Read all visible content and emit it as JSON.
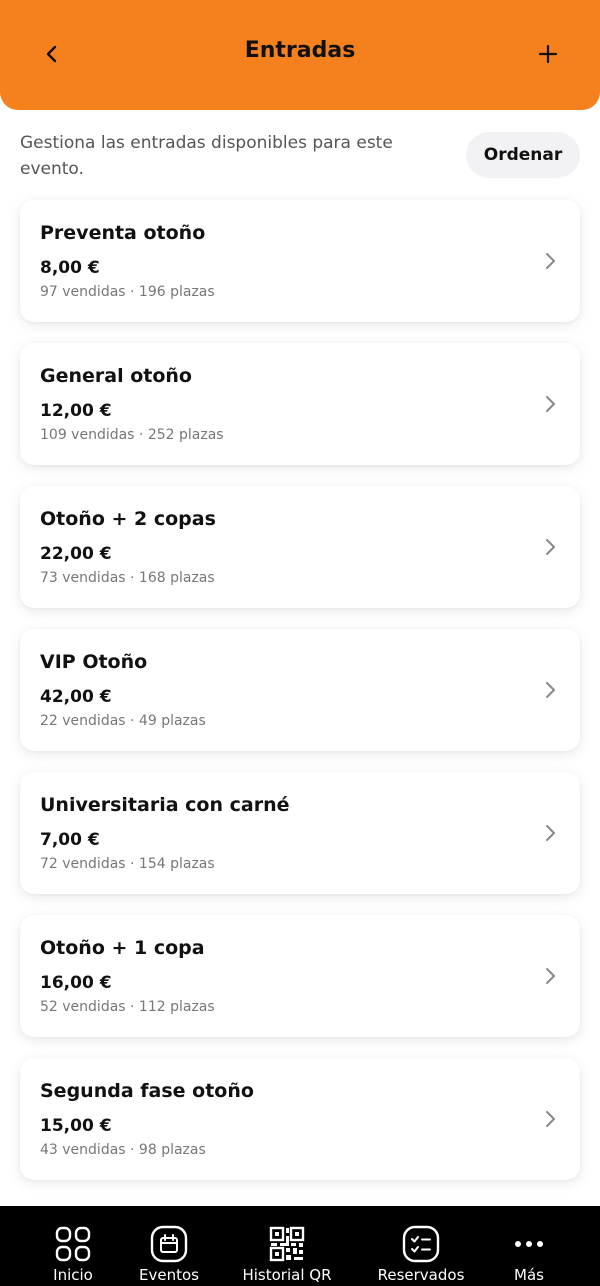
{
  "header": {
    "title": "Entradas",
    "back_icon": "chevron-left-icon",
    "add_icon": "plus-icon",
    "color": "#f5801e"
  },
  "intro": {
    "text": "Gestiona las entradas disponibles para este evento.",
    "order_label": "Ordenar"
  },
  "tickets": [
    {
      "name": "Preventa otoño",
      "price": "8,00 €",
      "meta": "97 vendidas · 196 plazas"
    },
    {
      "name": "General otoño",
      "price": "12,00 €",
      "meta": "109 vendidas · 252 plazas"
    },
    {
      "name": "Otoño + 2 copas",
      "price": "22,00 €",
      "meta": "73 vendidas · 168 plazas"
    },
    {
      "name": "VIP Otoño",
      "price": "42,00 €",
      "meta": "22 vendidas · 49 plazas"
    },
    {
      "name": "Universitaria con carné",
      "price": "7,00 €",
      "meta": "72 vendidas · 154 plazas"
    },
    {
      "name": "Otoño + 1 copa",
      "price": "16,00 €",
      "meta": "52 vendidas · 112 plazas"
    },
    {
      "name": "Segunda fase otoño",
      "price": "15,00 €",
      "meta": "43 vendidas · 98 plazas"
    }
  ],
  "tabbar": {
    "items": [
      {
        "label": "Inicio",
        "icon": "grid-icon"
      },
      {
        "label": "Eventos",
        "icon": "calendar-icon"
      },
      {
        "label": "Historial QR",
        "icon": "qr-code-icon"
      },
      {
        "label": "Reservados",
        "icon": "checklist-icon"
      },
      {
        "label": "Más",
        "icon": "more-icon"
      }
    ]
  }
}
